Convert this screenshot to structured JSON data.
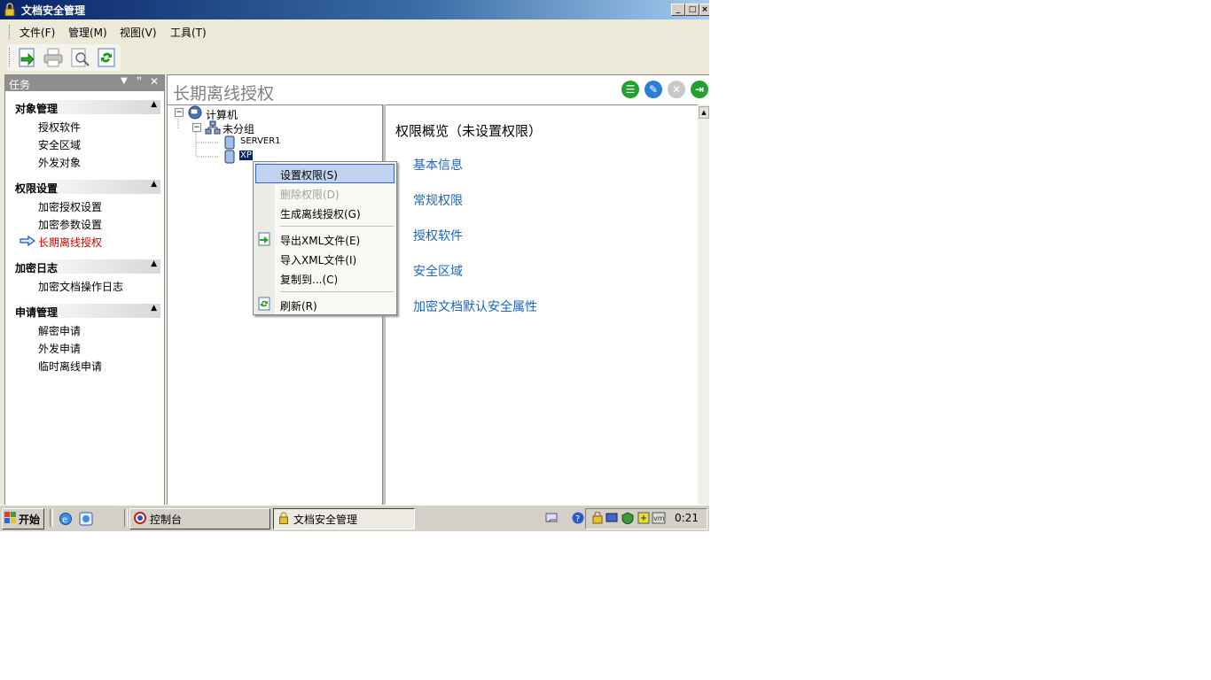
{
  "window": {
    "title": "文档安全管理"
  },
  "menu": [
    {
      "label": "文件(F)"
    },
    {
      "label": "管理(M)"
    },
    {
      "label": "视图(V)"
    },
    {
      "label": "工具(T)"
    }
  ],
  "toolbar": {
    "buttons": [
      "export-icon",
      "print-icon",
      "preview-icon",
      "refresh-icon"
    ]
  },
  "task_pane": {
    "header": "任务",
    "sections": [
      {
        "title": "对象管理",
        "items": [
          "授权软件",
          "安全区域",
          "外发对象"
        ]
      },
      {
        "title": "权限设置",
        "items": [
          "加密授权设置",
          "加密参数设置",
          "长期离线授权"
        ],
        "active_item": "长期离线授权"
      },
      {
        "title": "加密日志",
        "items": [
          "加密文档操作日志"
        ]
      },
      {
        "title": "申请管理",
        "items": [
          "解密申请",
          "外发申请",
          "临时离线申请"
        ]
      }
    ]
  },
  "main": {
    "title": "长期离线授权"
  },
  "tree": {
    "root": "计算机",
    "group": "未分组",
    "computers": [
      "SERVER1",
      "XP"
    ],
    "selected": "XP"
  },
  "overview": {
    "title": "权限概览（未设置权限）",
    "links": [
      "基本信息",
      "常规权限",
      "授权软件",
      "安全区域",
      "加密文档默认安全属性"
    ]
  },
  "context_menu": {
    "items": [
      {
        "label": "设置权限(S)",
        "state": "highlighted"
      },
      {
        "label": "删除权限(D)",
        "state": "disabled"
      },
      {
        "label": "生成离线授权(G)",
        "state": "normal"
      },
      {
        "label": "导出XML文件(E)",
        "state": "normal"
      },
      {
        "label": "导入XML文件(I)",
        "state": "normal"
      },
      {
        "label": "复制到...(C)",
        "state": "normal"
      },
      {
        "label": "刷新(R)",
        "state": "normal"
      }
    ]
  },
  "taskbar": {
    "start": "开始",
    "tasks": [
      "控制台",
      "文档安全管理"
    ],
    "active_task": "文档安全管理",
    "clock": "0:21"
  },
  "colors": {
    "title_start": "#0a246a",
    "link": "#1c66b9",
    "active_task": "#d00000",
    "selection": "#c1d2ee"
  }
}
